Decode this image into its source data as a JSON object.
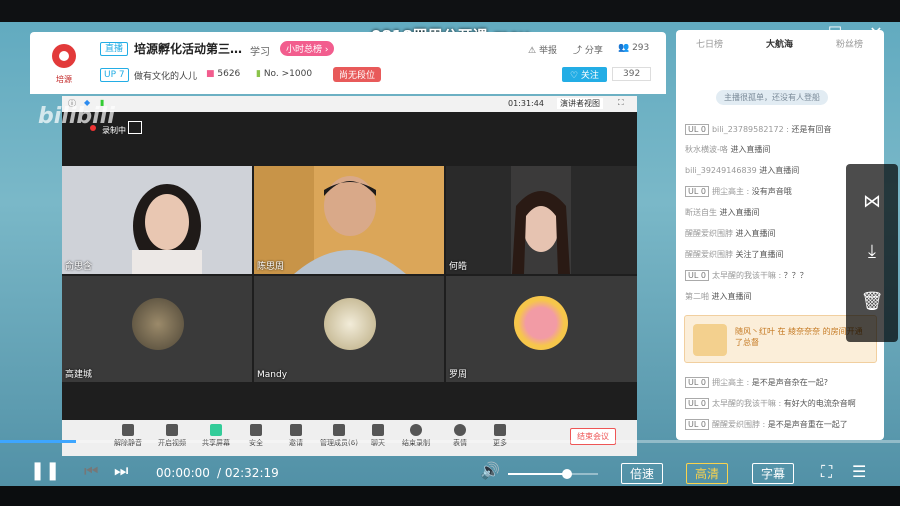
{
  "window": {
    "title": "0818罗周公开课.mov"
  },
  "live_header": {
    "logo_text": "培源",
    "live_badge": "直播",
    "room_title": "培源孵化活动第三…",
    "category": "学习",
    "rank_button": "小时总榜 ›",
    "report": "举报",
    "share": "分享",
    "viewer_count": "293",
    "up_level": "UP 7",
    "streamer_name": "做有文化的人儿",
    "gift_count": "5626",
    "rank": "No. >1000",
    "guard_button": "尚无段位",
    "follow_button": "♡ 关注",
    "follower_count": "392"
  },
  "meeting": {
    "timer": "01:31:44",
    "speaker_view": "演讲者视图",
    "recording": "录制中",
    "watermark": "bilibili",
    "participants": [
      {
        "name": "俞思含",
        "kind": "video"
      },
      {
        "name": "陈思周",
        "kind": "video"
      },
      {
        "name": "何皓",
        "kind": "video"
      },
      {
        "name": "高建城",
        "kind": "avatar"
      },
      {
        "name": "Mandy",
        "kind": "avatar"
      },
      {
        "name": "罗周",
        "kind": "avatar"
      }
    ],
    "toolbar": [
      "解除静音",
      "开启视频",
      "共享屏幕",
      "安全",
      "邀请",
      "管理成员(6)",
      "聊天",
      "结束录制",
      "表情",
      "更多"
    ],
    "end_meeting": "结束会议"
  },
  "side_panel": {
    "tabs": [
      "七日榜",
      "大航海",
      "粉丝榜"
    ],
    "active_tab": "大航海",
    "banner": "主播很孤单，还没有人登船",
    "chat": [
      {
        "level": "UL 0",
        "user": "bili_23789582172 :",
        "msg": "还是有回音"
      },
      {
        "level": "",
        "user": "秋水横波-咯",
        "msg": "进入直播间"
      },
      {
        "level": "",
        "user": "bili_39249146839",
        "msg": "进入直播间"
      },
      {
        "level": "UL 0",
        "user": "拥尘高主 :",
        "msg": "没有声音哦"
      },
      {
        "level": "",
        "user": "断送自生",
        "msg": "进入直播间"
      },
      {
        "level": "",
        "user": "醒醒爱织围脖",
        "msg": "进入直播间"
      },
      {
        "level": "",
        "user": "醒醒爱织围脖",
        "msg": "关注了直播间"
      },
      {
        "level": "UL 0",
        "user": "太早醒的我该干嘛 :",
        "msg": "？？？"
      },
      {
        "level": "",
        "user": "第二啪",
        "msg": "进入直播间"
      }
    ],
    "gift_notice": "随风丶红叶 在 綾奈奈奈 的房间开通了总督",
    "chat_after": [
      {
        "level": "UL 0",
        "user": "拥尘高主 :",
        "msg": "是不是声音杂在一起?"
      },
      {
        "level": "UL 0",
        "user": "太早醒的我该干嘛 :",
        "msg": "有好大的电流杂音啊"
      },
      {
        "level": "UL 0",
        "user": "醒醒爱织围脖 :",
        "msg": "是不是声音重在一起了"
      }
    ]
  },
  "player": {
    "progress_fraction": 0.084,
    "time_current": "00:00:00",
    "time_total": "/ 02:32:19",
    "volume_fraction": 0.65,
    "speed_button": "倍速",
    "quality_button": "高清",
    "subtitle_button": "字幕"
  },
  "colors": {
    "bilibili_blue": "#23ade5",
    "bilibili_pink": "#f25d8e",
    "progress": "#3ea6ff"
  }
}
